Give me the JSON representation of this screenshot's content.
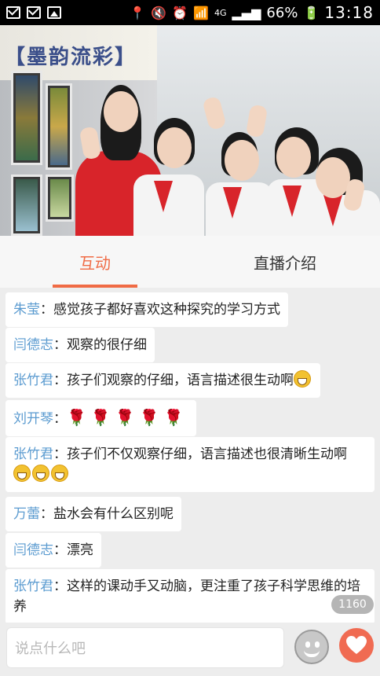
{
  "status_bar": {
    "battery_percent": "66%",
    "time": "13:18",
    "network": "4G"
  },
  "video": {
    "banner_text": "【墨韵流彩】",
    "description": "live video stream of teacher and students in classroom"
  },
  "tabs": [
    {
      "label": "互动",
      "active": true
    },
    {
      "label": "直播介绍",
      "active": false
    }
  ],
  "messages": [
    {
      "user": "朱莹",
      "text": "感觉孩子都好喜欢这种探究的学习方式",
      "emoji_count": 0
    },
    {
      "user": "闫德志",
      "text": "观察的很仔细",
      "emoji_count": 0
    },
    {
      "user": "张竹君",
      "text": "孩子们观察的仔细，语言描述很生动啊",
      "emoji_count": 1
    },
    {
      "user": "刘开琴",
      "text": "",
      "rose_count": 5
    },
    {
      "user": "张竹君",
      "text": "孩子们不仅观察仔细，语言描述也很清晰生动啊",
      "emoji_count": 3
    },
    {
      "user": "万蕾",
      "text": "盐水会有什么区别呢",
      "emoji_count": 0
    },
    {
      "user": "闫德志",
      "text": "漂亮",
      "emoji_count": 0
    },
    {
      "user": "张竹君",
      "text": "这样的课动手又动脑，更注重了孩子科学思维的培养",
      "emoji_count": 0
    }
  ],
  "separator": "：",
  "viewer_count": "1160",
  "input": {
    "placeholder": "说点什么吧"
  },
  "colors": {
    "accent": "#f06b45",
    "username": "#5b9bd0",
    "like": "#f06b52"
  }
}
